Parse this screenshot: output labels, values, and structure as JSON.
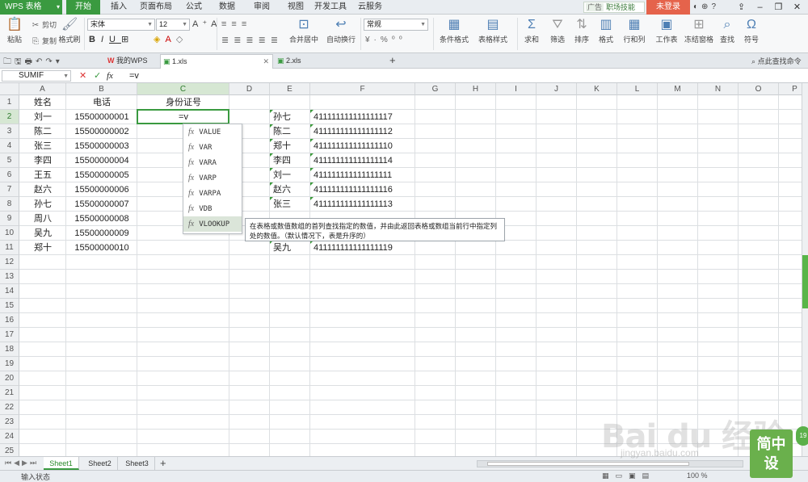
{
  "app": {
    "title": "WPS 表格",
    "login": "未登录",
    "ad": {
      "tag": "广告",
      "text": "职场技能"
    }
  },
  "menu": [
    "开始",
    "插入",
    "页面布局",
    "公式",
    "数据",
    "审阅",
    "视图",
    "开发工具",
    "云服务"
  ],
  "ribbon": {
    "paste": "粘贴",
    "cut": "剪切",
    "copy": "复制",
    "format_painter": "格式刷",
    "font": "宋体",
    "size": "12",
    "merge_center": "合并居中",
    "wrap": "自动换行",
    "num_format": "常规",
    "cond_format": "条件格式",
    "table_style": "表格样式",
    "sum": "求和",
    "filter": "筛选",
    "sort": "排序",
    "format": "格式",
    "rows_cols": "行和列",
    "worksheet": "工作表",
    "freeze": "冻结窗格",
    "find": "查找",
    "symbol": "符号"
  },
  "tabs": {
    "wps": "我的WPS",
    "doc1": "1.xls",
    "doc2": "2.xls",
    "help": "点此查找命令"
  },
  "formula": {
    "name_box": "SUMIF",
    "content": "=v"
  },
  "columns": [
    "A",
    "B",
    "C",
    "D",
    "E",
    "F",
    "G",
    "H",
    "I",
    "J",
    "K",
    "L",
    "M",
    "N",
    "O",
    "P"
  ],
  "rows": [
    "1",
    "2",
    "3",
    "4",
    "5",
    "6",
    "7",
    "8",
    "9",
    "10",
    "11",
    "12",
    "13",
    "14",
    "15",
    "16",
    "17",
    "18",
    "19",
    "20",
    "21",
    "22",
    "23",
    "24",
    "25"
  ],
  "cells": [
    {
      "r": 0,
      "c": 0,
      "v": "姓名",
      "a": "center"
    },
    {
      "r": 0,
      "c": 1,
      "v": "电话",
      "a": "center"
    },
    {
      "r": 0,
      "c": 2,
      "v": "身份证号",
      "a": "center"
    },
    {
      "r": 1,
      "c": 0,
      "v": "刘一",
      "a": "center"
    },
    {
      "r": 1,
      "c": 1,
      "v": "15500000001",
      "a": "center"
    },
    {
      "r": 1,
      "c": 2,
      "v": "=v",
      "a": "center"
    },
    {
      "r": 1,
      "c": 4,
      "v": "孙七",
      "a": "left"
    },
    {
      "r": 1,
      "c": 5,
      "v": "411111111111111117",
      "a": "left"
    },
    {
      "r": 2,
      "c": 0,
      "v": "陈二",
      "a": "center"
    },
    {
      "r": 2,
      "c": 1,
      "v": "15500000002",
      "a": "center"
    },
    {
      "r": 2,
      "c": 4,
      "v": "陈二",
      "a": "left"
    },
    {
      "r": 2,
      "c": 5,
      "v": "411111111111111112",
      "a": "left"
    },
    {
      "r": 3,
      "c": 0,
      "v": "张三",
      "a": "center"
    },
    {
      "r": 3,
      "c": 1,
      "v": "15500000003",
      "a": "center"
    },
    {
      "r": 3,
      "c": 4,
      "v": "郑十",
      "a": "left"
    },
    {
      "r": 3,
      "c": 5,
      "v": "411111111111111110",
      "a": "left"
    },
    {
      "r": 4,
      "c": 0,
      "v": "李四",
      "a": "center"
    },
    {
      "r": 4,
      "c": 1,
      "v": "15500000004",
      "a": "center"
    },
    {
      "r": 4,
      "c": 4,
      "v": "李四",
      "a": "left"
    },
    {
      "r": 4,
      "c": 5,
      "v": "411111111111111114",
      "a": "left"
    },
    {
      "r": 5,
      "c": 0,
      "v": "王五",
      "a": "center"
    },
    {
      "r": 5,
      "c": 1,
      "v": "15500000005",
      "a": "center"
    },
    {
      "r": 5,
      "c": 4,
      "v": "刘一",
      "a": "left"
    },
    {
      "r": 5,
      "c": 5,
      "v": "411111111111111111",
      "a": "left"
    },
    {
      "r": 6,
      "c": 0,
      "v": "赵六",
      "a": "center"
    },
    {
      "r": 6,
      "c": 1,
      "v": "15500000006",
      "a": "center"
    },
    {
      "r": 6,
      "c": 4,
      "v": "赵六",
      "a": "left"
    },
    {
      "r": 6,
      "c": 5,
      "v": "411111111111111116",
      "a": "left"
    },
    {
      "r": 7,
      "c": 0,
      "v": "孙七",
      "a": "center"
    },
    {
      "r": 7,
      "c": 1,
      "v": "15500000007",
      "a": "center"
    },
    {
      "r": 7,
      "c": 4,
      "v": "张三",
      "a": "left"
    },
    {
      "r": 7,
      "c": 5,
      "v": "411111111111111113",
      "a": "left"
    },
    {
      "r": 8,
      "c": 0,
      "v": "周八",
      "a": "center"
    },
    {
      "r": 8,
      "c": 1,
      "v": "15500000008",
      "a": "center"
    },
    {
      "r": 9,
      "c": 0,
      "v": "吴九",
      "a": "center"
    },
    {
      "r": 9,
      "c": 1,
      "v": "15500000009",
      "a": "center"
    },
    {
      "r": 10,
      "c": 0,
      "v": "郑十",
      "a": "center"
    },
    {
      "r": 10,
      "c": 1,
      "v": "15500000010",
      "a": "center"
    },
    {
      "r": 10,
      "c": 4,
      "v": "吴九",
      "a": "left"
    },
    {
      "r": 10,
      "c": 5,
      "v": "411111111111111119",
      "a": "left"
    }
  ],
  "autocomplete": [
    "VALUE",
    "VAR",
    "VARA",
    "VARP",
    "VARPA",
    "VDB",
    "VLOOKUP"
  ],
  "tooltip": "在表格或数值数组的首列查找指定的数值，并由此返回表格或数组当前行中指定列处的数值。（默认情况下，表是升序的）",
  "sheets": [
    "Sheet1",
    "Sheet2",
    "Sheet3"
  ],
  "status": {
    "mode": "输入状态",
    "zoom": "100 %"
  },
  "watermark": {
    "logo": "Bai du 经验",
    "url": "jingyan.baidu.com",
    "badge": "简中设",
    "side": "19"
  }
}
